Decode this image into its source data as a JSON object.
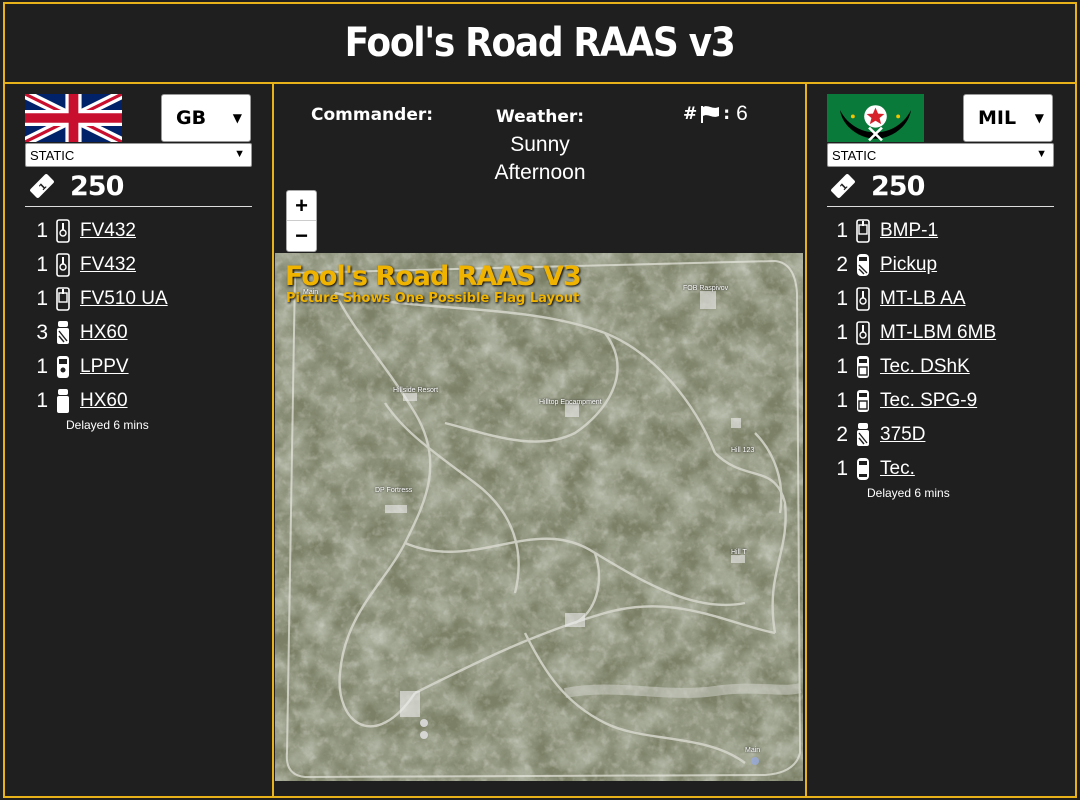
{
  "title": "Fool's Road RAAS v3",
  "left_team": {
    "faction": "GB",
    "layer_mode": "STATIC",
    "tickets": "250",
    "vehicles": [
      {
        "count": "1",
        "name": "FV432",
        "icon": "apc-icon"
      },
      {
        "count": "1",
        "name": "FV432",
        "icon": "apc-icon"
      },
      {
        "count": "1",
        "name": "FV510 UA",
        "icon": "ifv-icon"
      },
      {
        "count": "3",
        "name": "HX60",
        "icon": "logistics-truck-icon"
      },
      {
        "count": "1",
        "name": "LPPV",
        "icon": "mrap-icon"
      },
      {
        "count": "1",
        "name": "HX60",
        "icon": "transport-truck-icon"
      }
    ],
    "delay_note": "Delayed 6 mins"
  },
  "right_team": {
    "faction": "MIL",
    "layer_mode": "STATIC",
    "tickets": "250",
    "vehicles": [
      {
        "count": "1",
        "name": "BMP-1",
        "icon": "ifv-icon"
      },
      {
        "count": "2",
        "name": "Pickup",
        "icon": "logistics-car-icon"
      },
      {
        "count": "1",
        "name": "MT-LB AA",
        "icon": "apc-icon"
      },
      {
        "count": "1",
        "name": "MT-LBM 6MB",
        "icon": "apc-icon"
      },
      {
        "count": "1",
        "name": "Tec. DShK",
        "icon": "technical-icon"
      },
      {
        "count": "1",
        "name": "Tec. SPG-9",
        "icon": "technical-icon"
      },
      {
        "count": "2",
        "name": "375D",
        "icon": "logistics-truck-icon"
      },
      {
        "count": "1",
        "name": "Tec.",
        "icon": "car-icon"
      }
    ],
    "delay_note": "Delayed 6 mins"
  },
  "info": {
    "commander_label": "Commander:",
    "commander_value": "",
    "weather_label": "Weather:",
    "weather_value_1": "Sunny",
    "weather_value_2": "Afternoon",
    "flags_prefix": "#",
    "flags_sep": ":",
    "flags_count": "6"
  },
  "map": {
    "zoom_in": "+",
    "zoom_out": "−",
    "title": "Fool's Road RAAS V3",
    "subtitle": "Picture Shows One Possible Flag Layout",
    "locations": {
      "main_nw": "Main",
      "fob": "FOB Raspivov",
      "hillside": "Hillside Resort",
      "hilltop": "Hilltop Encampment",
      "hill123": "Hill 123",
      "fortress": "DP Fortress",
      "hill_t": "Hill T",
      "main_se": "Main"
    }
  },
  "colors": {
    "accent": "#e8b21a",
    "background": "#1f1f1f",
    "map_title": "#f0b400"
  }
}
